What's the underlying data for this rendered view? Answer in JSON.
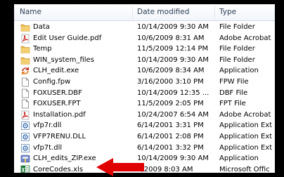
{
  "columns": {
    "name": "Name",
    "date": "Date modified",
    "type": "Type"
  },
  "files": [
    {
      "name": "Data",
      "date": "10/14/2009 9:30 AM",
      "type": "File Folder",
      "icon": "folder-icon"
    },
    {
      "name": "Edit User Guide.pdf",
      "date": "10/6/2009 8:31 AM",
      "type": "Adobe Acrobat",
      "icon": "pdf-icon"
    },
    {
      "name": "Temp",
      "date": "11/5/2009 12:14 PM",
      "type": "File Folder",
      "icon": "folder-icon"
    },
    {
      "name": "WIN_system_files",
      "date": "10/14/2009 9:30 AM",
      "type": "File Folder",
      "icon": "folder-icon"
    },
    {
      "name": "CLH_edit.exe",
      "date": "10/6/2009 8:34 AM",
      "type": "Application",
      "icon": "app-icon"
    },
    {
      "name": "Config.fpw",
      "date": "3/16/2000 3:10 PM",
      "type": "FPW File",
      "icon": "file-icon"
    },
    {
      "name": "FOXUSER.DBF",
      "date": "10/14/2009 12:35 ...",
      "type": "DBF File",
      "icon": "file-icon"
    },
    {
      "name": "FOXUSER.FPT",
      "date": "11/5/2009 2:05 PM",
      "type": "FPT File",
      "icon": "file-icon"
    },
    {
      "name": "Installation.pdf",
      "date": "10/24/2007 6:54 AM",
      "type": "Adobe Acrobat",
      "icon": "pdf-icon"
    },
    {
      "name": "vfp7r.dll",
      "date": "6/14/2001 3:31 PM",
      "type": "Application Ext",
      "icon": "dll-icon"
    },
    {
      "name": "VFP7RENU.DLL",
      "date": "6/14/2001 2:08 PM",
      "type": "Application Ext",
      "icon": "dll-icon"
    },
    {
      "name": "vfp7t.dll",
      "date": "6/14/2001 3:32 PM",
      "type": "Application Ext",
      "icon": "dll-icon"
    },
    {
      "name": "CLH_edits_ZIP.exe",
      "date": "10/14/2009 9:30 AM",
      "type": "Application",
      "icon": "zip-exe-icon"
    },
    {
      "name": "CoreCodes.xls",
      "date": "8/2009 8:03 AM",
      "type": "Microsoft Offic",
      "icon": "excel-icon"
    }
  ],
  "colors": {
    "frame": "#000000",
    "header_text": "#2e3e56",
    "arrow": "#e00000",
    "folder": "#e8b84a",
    "pdf": "#c8201e",
    "excel": "#1f7a3a"
  }
}
